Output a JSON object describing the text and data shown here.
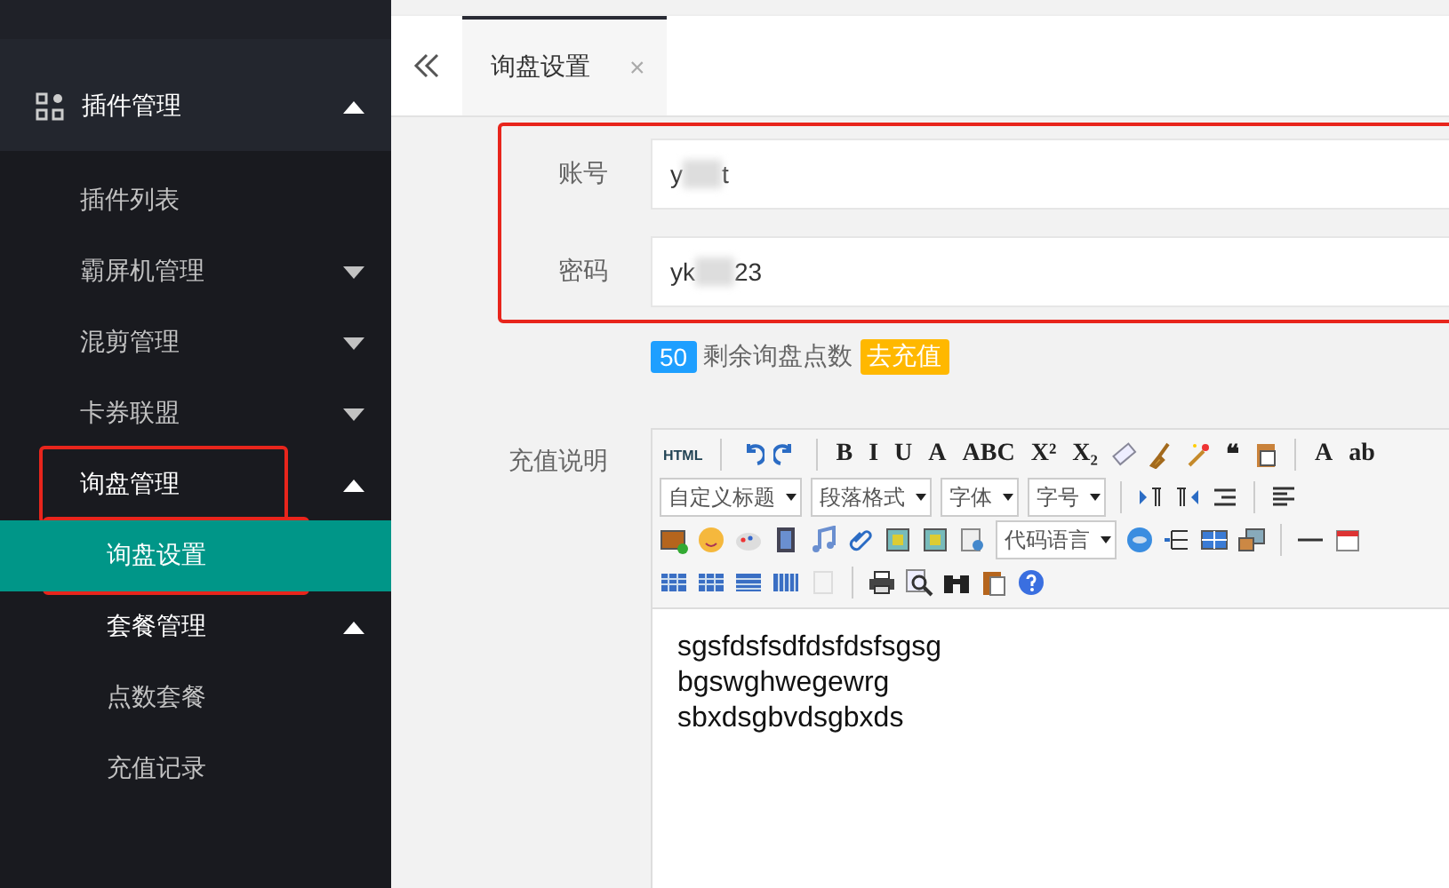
{
  "sidebar": {
    "items": [
      {
        "label": "插件管理",
        "kind": "group",
        "expanded": true,
        "annotated": false,
        "selected": false,
        "children": [
          {
            "label": "插件列表",
            "kind": "leaf",
            "annotated": false,
            "selected": false
          },
          {
            "label": "霸屏机管理",
            "kind": "folder",
            "expanded": false,
            "annotated": false,
            "selected": false
          },
          {
            "label": "混剪管理",
            "kind": "folder",
            "expanded": false,
            "annotated": false,
            "selected": false
          },
          {
            "label": "卡券联盟",
            "kind": "folder",
            "expanded": false,
            "annotated": false,
            "selected": false
          },
          {
            "label": "询盘管理",
            "kind": "folder",
            "expanded": true,
            "annotated": true,
            "selected": false,
            "children": [
              {
                "label": "询盘设置",
                "kind": "leaf",
                "annotated": true,
                "selected": true
              },
              {
                "label": "套餐管理",
                "kind": "folder",
                "expanded": true,
                "annotated": false,
                "selected": false,
                "children": [
                  {
                    "label": "点数套餐",
                    "kind": "leaf",
                    "annotated": false,
                    "selected": false
                  },
                  {
                    "label": "充值记录",
                    "kind": "leaf",
                    "annotated": false,
                    "selected": false
                  }
                ]
              }
            ]
          }
        ]
      }
    ]
  },
  "tabs": [
    {
      "label": "询盘设置",
      "selected": true,
      "close": "×"
    }
  ],
  "form": {
    "annotated": true,
    "fields": [
      {
        "label": "账号",
        "value_start": "y",
        "value_end": "t"
      },
      {
        "label": "密码",
        "value_start": "yk",
        "value_end": "23"
      }
    ],
    "points": {
      "count": "50",
      "text": "剩余询盘点数",
      "action": "去充值"
    },
    "editor_label": "充值说明"
  },
  "editor": {
    "toolbar": [
      [
        {
          "kind": "glyph",
          "label": "HTML"
        },
        {
          "kind": "separator"
        },
        {
          "kind": "icon"
        },
        {
          "kind": "icon"
        },
        {
          "kind": "separator"
        },
        {
          "kind": "glyph",
          "label": "B"
        },
        {
          "kind": "glyph",
          "label": "I"
        },
        {
          "kind": "glyph",
          "label": "U"
        },
        {
          "kind": "glyph",
          "label": "A"
        },
        {
          "kind": "glyph",
          "label": "ABC"
        },
        {
          "kind": "glyph",
          "label": "X²"
        },
        {
          "kind": "glyph",
          "label": "X₂"
        },
        {
          "kind": "icon"
        },
        {
          "kind": "icon"
        },
        {
          "kind": "icon"
        },
        {
          "kind": "glyph",
          "label": "❝"
        },
        {
          "kind": "icon"
        },
        {
          "kind": "separator"
        },
        {
          "kind": "glyph",
          "label": "A"
        },
        {
          "kind": "glyph",
          "label": "ab"
        }
      ],
      [
        {
          "kind": "select",
          "label": "自定义标题"
        },
        {
          "kind": "select",
          "label": "段落格式"
        },
        {
          "kind": "select",
          "label": "字体"
        },
        {
          "kind": "select",
          "label": "字号"
        },
        {
          "kind": "separator"
        },
        {
          "kind": "icon"
        },
        {
          "kind": "icon"
        },
        {
          "kind": "icon"
        },
        {
          "kind": "separator"
        },
        {
          "kind": "icon"
        }
      ],
      [
        {
          "kind": "icon"
        },
        {
          "kind": "icon"
        },
        {
          "kind": "icon"
        },
        {
          "kind": "icon"
        },
        {
          "kind": "icon"
        },
        {
          "kind": "icon"
        },
        {
          "kind": "icon"
        },
        {
          "kind": "icon"
        },
        {
          "kind": "icon"
        },
        {
          "kind": "select",
          "label": "代码语言"
        },
        {
          "kind": "icon"
        },
        {
          "kind": "icon"
        },
        {
          "kind": "icon"
        },
        {
          "kind": "icon"
        },
        {
          "kind": "separator"
        },
        {
          "kind": "icon"
        },
        {
          "kind": "icon"
        }
      ],
      [
        {
          "kind": "icon"
        },
        {
          "kind": "icon"
        },
        {
          "kind": "icon"
        },
        {
          "kind": "icon"
        },
        {
          "kind": "icon"
        },
        {
          "kind": "separator"
        },
        {
          "kind": "icon"
        },
        {
          "kind": "icon"
        },
        {
          "kind": "icon"
        },
        {
          "kind": "icon"
        },
        {
          "kind": "icon"
        }
      ]
    ],
    "content": [
      "sgsfdsfsdfdsfdsfsgsg",
      "bgswghwegewrg",
      "sbxdsgbvdsgbxds"
    ]
  }
}
